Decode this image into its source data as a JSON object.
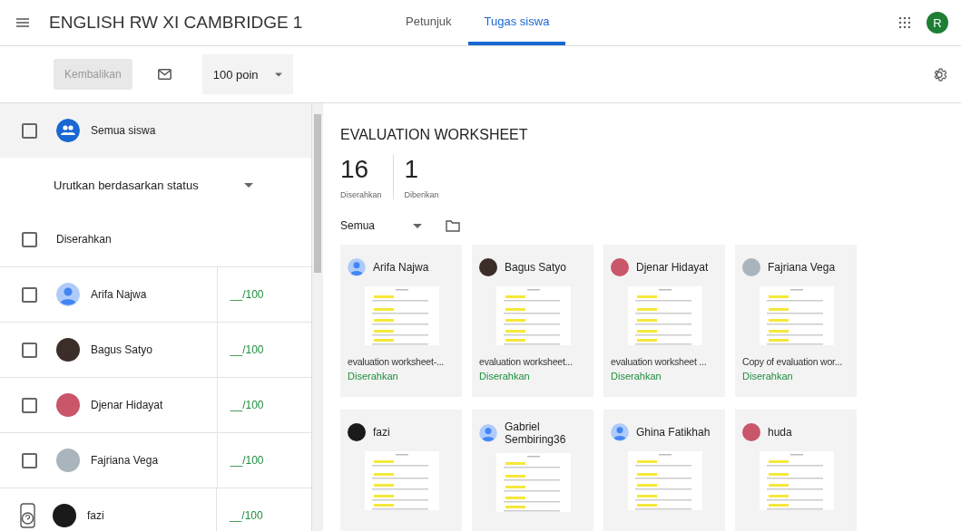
{
  "header": {
    "title": "ENGLISH RW XI CAMBRIDGE 1",
    "tabs": [
      {
        "label": "Petunjuk",
        "selected": false
      },
      {
        "label": "Tugas siswa",
        "selected": true
      }
    ],
    "account_letter": "R"
  },
  "toolbar": {
    "return_button": {
      "label": "Kembalikan",
      "disabled": true
    },
    "points": "100 poin"
  },
  "roster": {
    "all_students": {
      "label": "Semua siswa",
      "checked": false
    },
    "sort": "Urutkan berdasarkan status",
    "group": {
      "label": "Diserahkan",
      "checked": false
    },
    "students": [
      {
        "name": "Arifa Najwa",
        "grade": "__/100",
        "kind": "default",
        "checked": false
      },
      {
        "name": "Bagus Satyo",
        "grade": "__/100",
        "kind": "photo",
        "checked": false
      },
      {
        "name": "Djenar Hidayat",
        "grade": "__/100",
        "kind": "photo",
        "checked": false
      },
      {
        "name": "Fajriana Vega",
        "grade": "__/100",
        "kind": "photo",
        "checked": false
      },
      {
        "name": "fazi",
        "grade": "__/100",
        "kind": "photo"
      }
    ]
  },
  "assignment": {
    "title": "EVALUATION WORKSHEET",
    "stats": [
      {
        "value": "16",
        "label": "Diserahkan"
      },
      {
        "value": "1",
        "label": "Diberikan"
      }
    ],
    "filter": "Semua",
    "cards": [
      {
        "name": "Arifa Najwa",
        "kind": "default",
        "file": "evaluation worksheet-...",
        "status": "Diserahkan"
      },
      {
        "name": "Bagus Satyo",
        "kind": "photo",
        "file": "evaluation worksheet...",
        "status": "Diserahkan"
      },
      {
        "name": "Djenar Hidayat",
        "kind": "photo",
        "file": "evaluation worksheet ...",
        "status": "Diserahkan"
      },
      {
        "name": "Fajriana Vega",
        "kind": "photo",
        "file": "Copy of evaluation wor...",
        "status": "Diserahkan"
      },
      {
        "name": "fazi",
        "kind": "photo"
      },
      {
        "name": "Gabriel Sembiring36",
        "kind": "default"
      },
      {
        "name": "Ghina Fatikhah",
        "kind": "default"
      },
      {
        "name": "huda",
        "kind": "photo"
      }
    ]
  }
}
